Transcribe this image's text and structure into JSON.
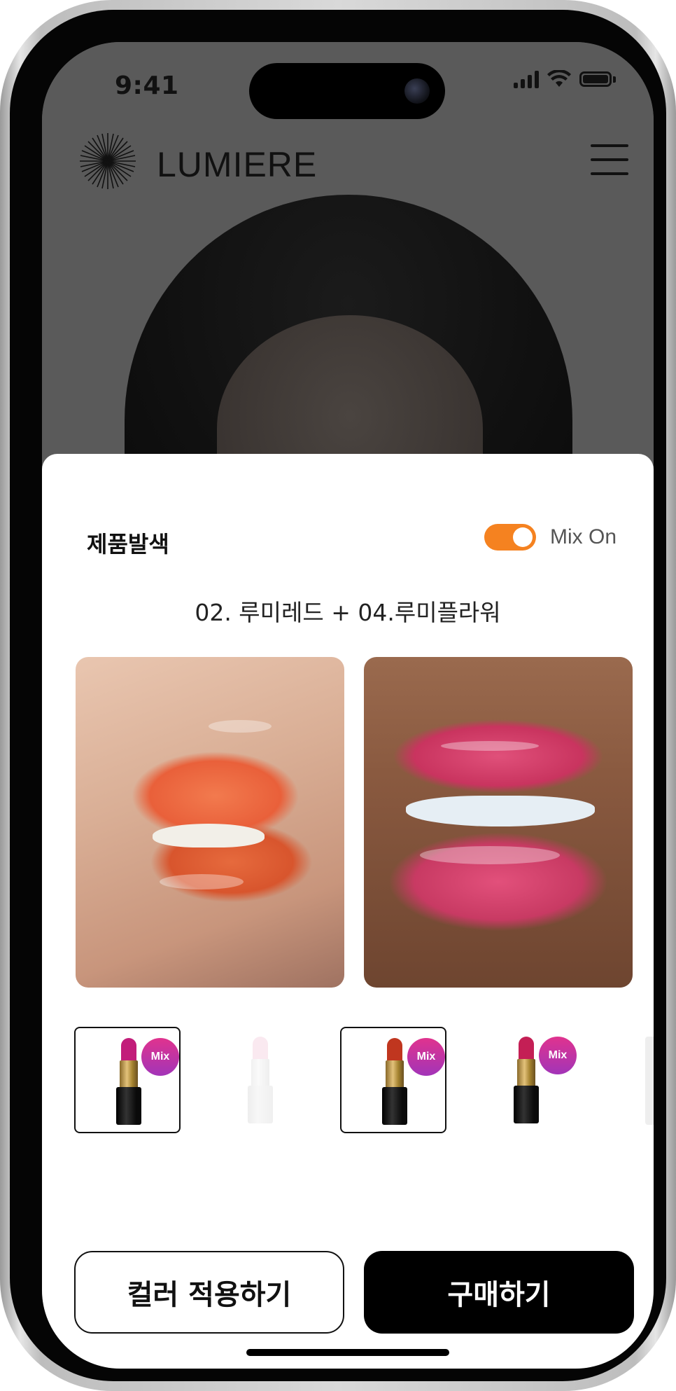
{
  "status_bar": {
    "time": "9:41"
  },
  "header": {
    "brand": "LUMIERE",
    "logo_icon": "starburst-logo-icon",
    "menu_icon": "hamburger-menu-icon"
  },
  "sheet": {
    "title": "제품발색",
    "mix_toggle": {
      "label": "Mix On",
      "on": true,
      "color": "#f58220"
    },
    "combination": "02. 루미레드 + 04.루미플라워",
    "swatches": [
      {
        "name": "orange-lip-swatch",
        "color": "#e9603a"
      },
      {
        "name": "pink-lip-swatch",
        "color": "#c9345f"
      }
    ],
    "products": [
      {
        "bullet_color": "#c21d7a",
        "mix_badge": "Mix",
        "selected": true,
        "faded": false
      },
      {
        "bullet_color": "#f3c2d6",
        "mix_badge": "",
        "selected": false,
        "faded": true
      },
      {
        "bullet_color": "#c0361f",
        "mix_badge": "Mix",
        "selected": true,
        "faded": false
      },
      {
        "bullet_color": "#c41f55",
        "mix_badge": "Mix",
        "selected": false,
        "faded": false
      }
    ]
  },
  "buttons": {
    "apply_color": "컬러 적용하기",
    "buy": "구매하기"
  }
}
